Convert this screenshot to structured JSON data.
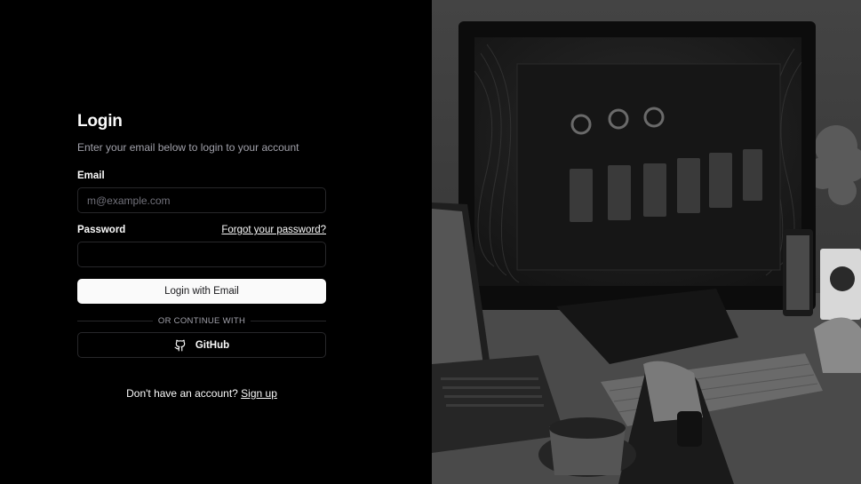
{
  "login": {
    "title": "Login",
    "subtitle": "Enter your email below to login to your account",
    "email_label": "Email",
    "email_placeholder": "m@example.com",
    "email_value": "",
    "password_label": "Password",
    "password_value": "",
    "forgot_label": "Forgot your password?",
    "submit_label": "Login with Email",
    "divider_label": "OR CONTINUE WITH",
    "github_label": "GitHub",
    "signup_prompt": "Don't have an account?",
    "signup_link": "Sign up"
  },
  "icons": {
    "github": "github-icon"
  },
  "colors": {
    "background": "#000000",
    "foreground": "#fafafa",
    "muted": "#a1a1aa",
    "border": "#27272a",
    "primary_button": "#fafafa",
    "primary_button_text": "#18181b"
  }
}
